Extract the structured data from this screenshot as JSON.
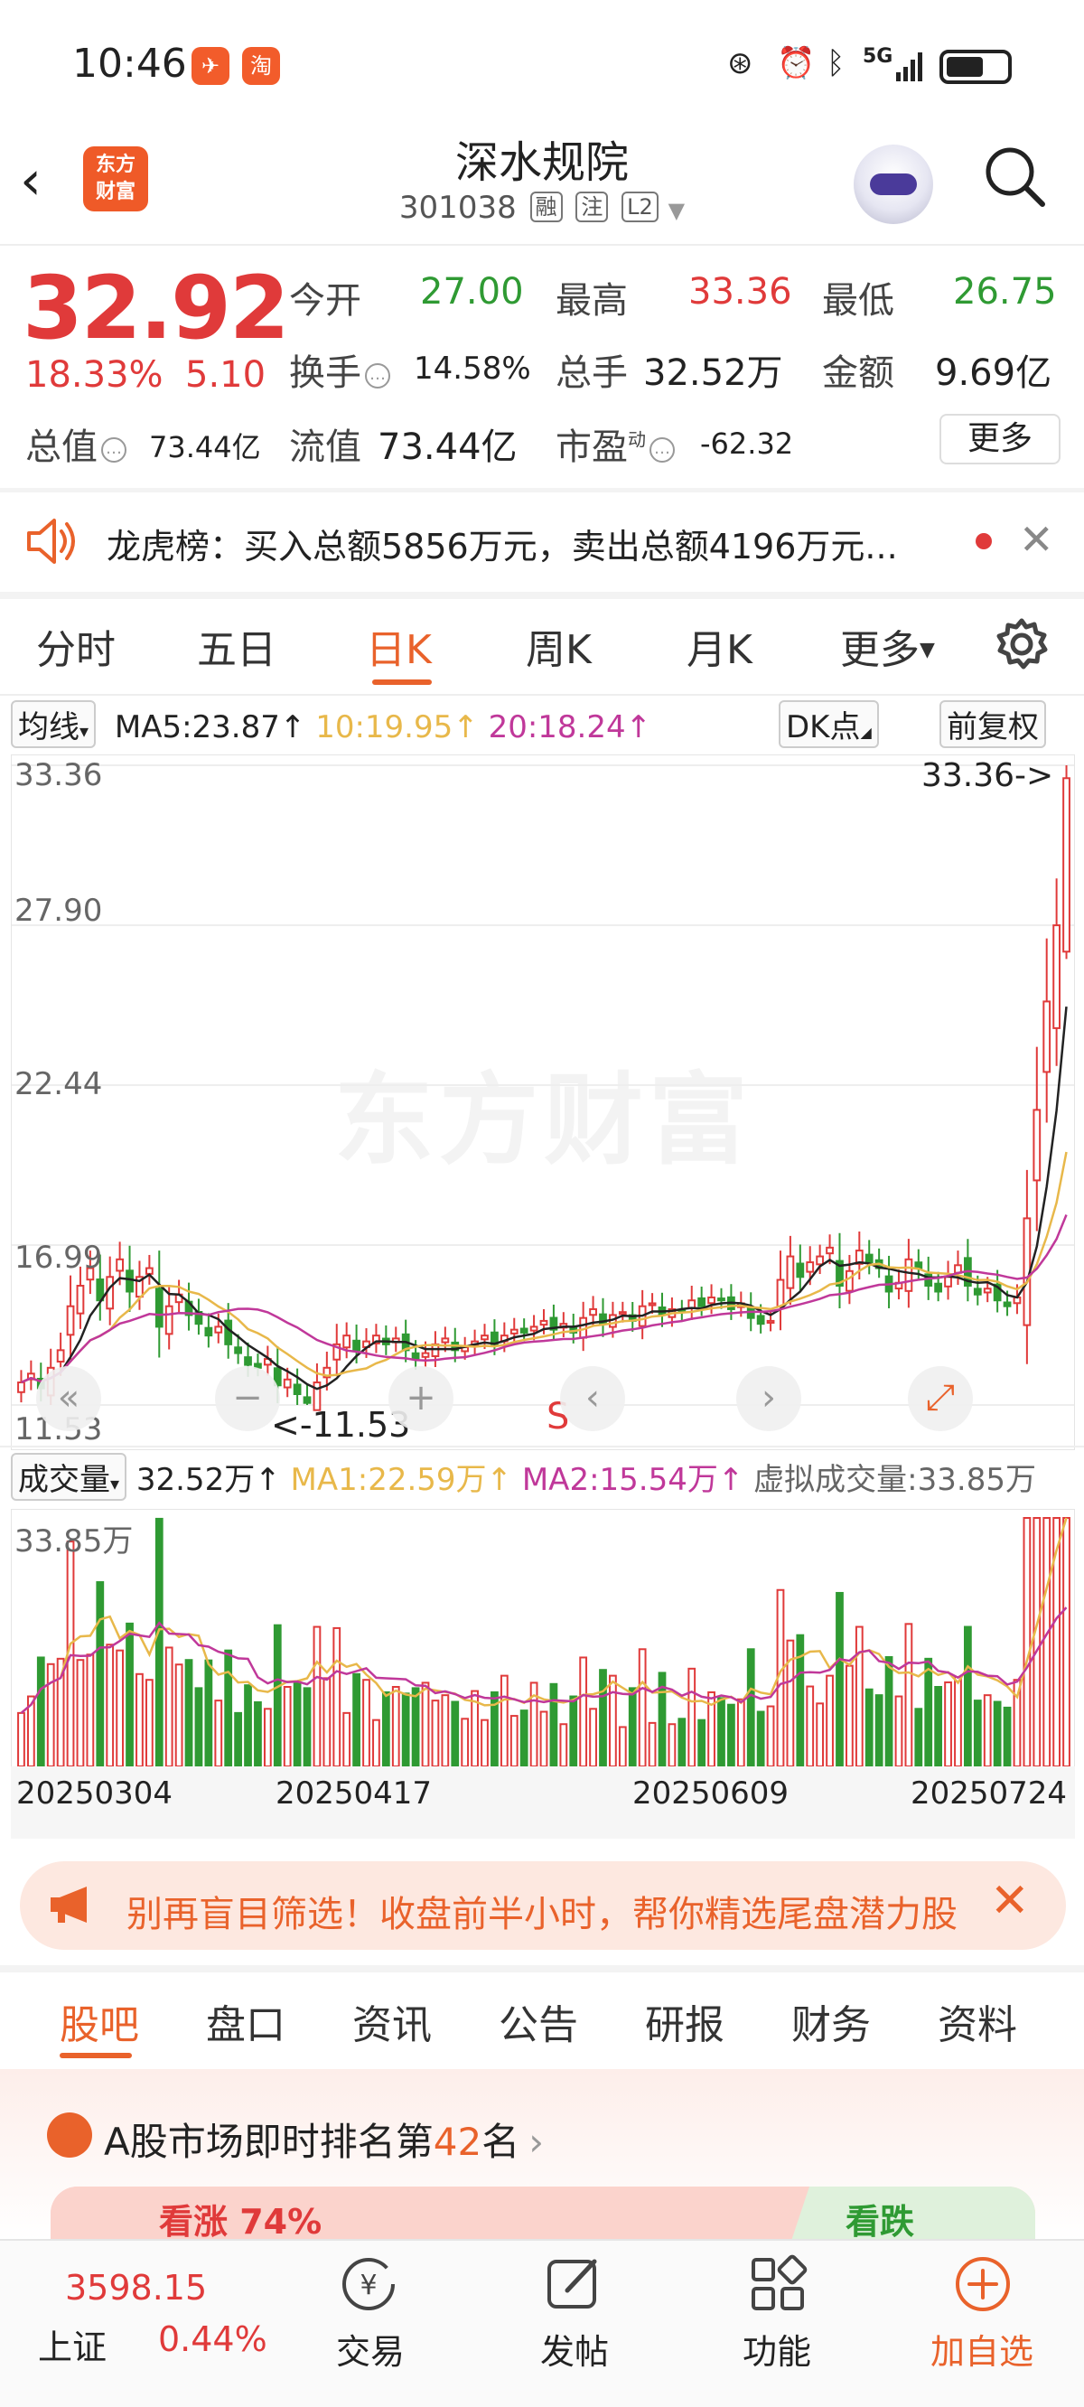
{
  "status": {
    "time": "10:46",
    "app1": "✈",
    "app2": "淘",
    "network": "5G"
  },
  "header": {
    "logo_line1": "东方",
    "logo_line2": "财富",
    "name": "深水规院",
    "code": "301038",
    "tags": [
      "融",
      "注",
      "L2"
    ]
  },
  "quote": {
    "price": "32.92",
    "pct": "18.33%",
    "chg": "5.10",
    "open_label": "今开",
    "open": "27.00",
    "high_label": "最高",
    "high": "33.36",
    "low_label": "最低",
    "low": "26.75",
    "turnover_label": "换手",
    "turnover": "14.58%",
    "vol_label": "总手",
    "vol": "32.52万",
    "amount_label": "金额",
    "amount": "9.69亿",
    "mktcap_label": "总值",
    "mktcap": "73.44亿",
    "float_label": "流值",
    "float": "73.44亿",
    "pe_label": "市盈",
    "pe_sup": "动",
    "pe": "-62.32",
    "more": "更多"
  },
  "dragon": {
    "text": "龙虎榜：买入总额5856万元，卖出总额4196万元..."
  },
  "period_tabs": [
    "分时",
    "五日",
    "日K",
    "周K",
    "月K",
    "更多"
  ],
  "ma": {
    "selector": "均线",
    "ma5": "MA5:23.87",
    "ma10": "10:19.95",
    "ma20": "20:18.24",
    "dk": "DK点",
    "fq": "前复权"
  },
  "chart": {
    "y_labels": [
      "33.36",
      "27.90",
      "22.44",
      "16.99",
      "11.53"
    ],
    "high_marker": "33.36->",
    "low_marker": "<-11.53",
    "s_marker": "S",
    "x_labels": [
      "20250304",
      "20250417",
      "20250609",
      "20250724"
    ],
    "watermark": "东方财富"
  },
  "volume": {
    "selector": "成交量",
    "vol": "32.52万",
    "ma1": "MA1:22.59万",
    "ma2": "MA2:15.54万",
    "virtual": "虚拟成交量:33.85万",
    "max_label": "33.85万"
  },
  "promo": {
    "text": "别再盲目筛选！收盘前半小时，帮你精选尾盘潜力股"
  },
  "bottom_tabs": [
    "股吧",
    "盘口",
    "资讯",
    "公告",
    "研报",
    "财务",
    "资料"
  ],
  "rank": {
    "prefix": "A股市场即时排名第",
    "num": "42",
    "suffix": "名",
    "up": "看涨 74%",
    "down": "看跌"
  },
  "nav": {
    "index_value": "3598.15",
    "index_name": "上证",
    "index_pct": "0.44%",
    "trade": "交易",
    "post": "发帖",
    "func": "功能",
    "add": "加自选"
  },
  "colors": {
    "up": "#e03a3a",
    "down": "#2f9a33",
    "accent": "#e9622b",
    "ma5": "#222222",
    "ma10": "#e8b84a",
    "ma20": "#c0389a"
  },
  "chart_data": {
    "type": "candlestick",
    "y_range": [
      11.53,
      33.36
    ],
    "last_close": 32.92,
    "closes": [
      12.3,
      12.6,
      12.1,
      12.8,
      13.4,
      14.9,
      15.6,
      16.2,
      15.1,
      15.9,
      16.5,
      15.4,
      15.9,
      16.2,
      14.2,
      14.9,
      15.3,
      14.6,
      14.3,
      13.9,
      14.2,
      13.6,
      13.3,
      12.9,
      12.8,
      13.1,
      12.2,
      12.4,
      11.9,
      11.6,
      12.3,
      12.8,
      13.6,
      13.9,
      13.4,
      13.7,
      13.9,
      13.6,
      13.8,
      13.4,
      13.1,
      13.3,
      13.6,
      13.8,
      13.4,
      13.5,
      13.7,
      13.9,
      13.6,
      13.9,
      14.1,
      14.0,
      14.2,
      14.4,
      14.1,
      14.3,
      14.0,
      14.5,
      14.8,
      14.3,
      14.6,
      14.7,
      14.4,
      14.9,
      15.0,
      14.6,
      14.8,
      14.7,
      15.1,
      14.9,
      15.2,
      15.1,
      14.8,
      15.0,
      14.5,
      14.3,
      14.4,
      15.8,
      16.6,
      15.9,
      16.4,
      16.6,
      16.9,
      15.6,
      16.1,
      16.8,
      16.4,
      16.2,
      15.4,
      15.7,
      16.5,
      16.2,
      15.6,
      15.4,
      15.9,
      16.3,
      15.6,
      15.3,
      15.5,
      15.1,
      14.9,
      15.2,
      17.9,
      21.6,
      25.3,
      27.9,
      32.92
    ]
  }
}
